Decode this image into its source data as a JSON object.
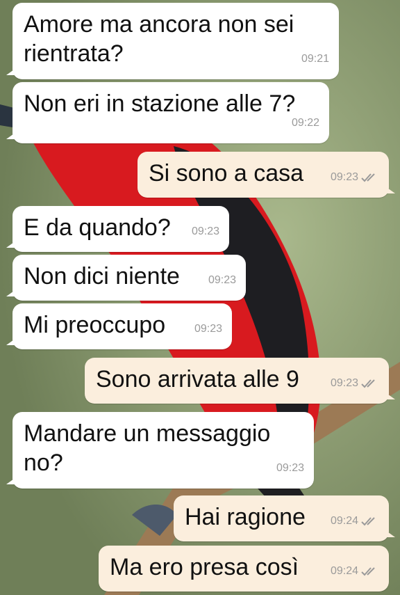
{
  "colors": {
    "incoming_bubble": "#ffffff",
    "outgoing_bubble": "#fbeedd",
    "tick_color": "#9a9a9a"
  },
  "messages": [
    {
      "text": "Amore ma ancora non sei\nrientrata?",
      "time": "09:21",
      "dir": "in"
    },
    {
      "text": "Non eri in stazione alle 7?",
      "time": "09:22",
      "dir": "in"
    },
    {
      "text": "Si sono a casa",
      "time": "09:23",
      "dir": "out"
    },
    {
      "text": "E da quando?",
      "time": "09:23",
      "dir": "in"
    },
    {
      "text": "Non dici niente",
      "time": "09:23",
      "dir": "in"
    },
    {
      "text": "Mi preoccupo",
      "time": "09:23",
      "dir": "in"
    },
    {
      "text": "Sono arrivata alle 9",
      "time": "09:23",
      "dir": "out"
    },
    {
      "text": "Mandare un messaggio\nno?",
      "time": "09:23",
      "dir": "in"
    },
    {
      "text": "Hai ragione",
      "time": "09:24",
      "dir": "out"
    },
    {
      "text": "Ma ero presa così",
      "time": "09:24",
      "dir": "out"
    }
  ]
}
